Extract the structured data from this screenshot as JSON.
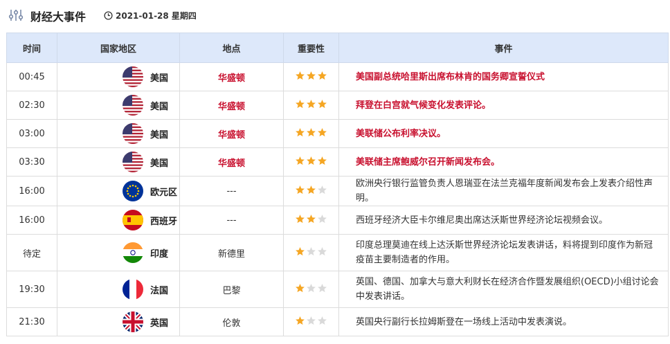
{
  "header": {
    "title": "财经大事件",
    "date": "2021-01-28 星期四"
  },
  "columns": [
    "时间",
    "国家地区",
    "地点",
    "重要性",
    "事件"
  ],
  "rows": [
    {
      "time": "00:45",
      "country": "美国",
      "flag": "us-flag",
      "location": "华盛顿",
      "importance": 3,
      "event": "美国副总统哈里斯出席布林肯的国务卿宣誓仪式",
      "highlight": true
    },
    {
      "time": "02:30",
      "country": "美国",
      "flag": "us-flag",
      "location": "华盛顿",
      "importance": 3,
      "event": "拜登在白宫就气候变化发表评论。",
      "highlight": true
    },
    {
      "time": "03:00",
      "country": "美国",
      "flag": "us-flag",
      "location": "华盛顿",
      "importance": 3,
      "event": "美联储公布利率决议。",
      "highlight": true
    },
    {
      "time": "03:30",
      "country": "美国",
      "flag": "us-flag",
      "location": "华盛顿",
      "importance": 3,
      "event": "美联储主席鲍威尔召开新闻发布会。",
      "highlight": true
    },
    {
      "time": "16:00",
      "country": "欧元区",
      "flag": "eu-flag",
      "location": "---",
      "importance": 2,
      "event": "欧洲央行银行监管负责人恩瑞亚在法兰克福年度新闻发布会上发表介绍性声明。",
      "highlight": false
    },
    {
      "time": "16:00",
      "country": "西班牙",
      "flag": "es-flag",
      "location": "---",
      "importance": 2,
      "event": "西班牙经济大臣卡尔维尼奥出席达沃斯世界经济论坛视频会议。",
      "highlight": false
    },
    {
      "time": "待定",
      "country": "印度",
      "flag": "in-flag",
      "location": "新德里",
      "importance": 1,
      "event": "印度总理莫迪在线上达沃斯世界经济论坛发表讲话，料将提到印度作为新冠疫苗主要制造者的作用。",
      "highlight": false
    },
    {
      "time": "19:30",
      "country": "法国",
      "flag": "fr-flag",
      "location": "巴黎",
      "importance": 1,
      "event": "英国、德国、加拿大与意大利财长在经济合作暨发展组织(OECD)小组讨论会中发表讲话。",
      "highlight": false
    },
    {
      "time": "21:30",
      "country": "英国",
      "flag": "gb-flag",
      "location": "伦敦",
      "importance": 1,
      "event": "英国央行副行长拉姆斯登在一场线上活动中发表演说。",
      "highlight": false
    }
  ],
  "colors": {
    "accent_red": "#c8102e",
    "header_bg": "#dde8fa",
    "star_on": "#f5a623",
    "star_off": "#d9d9d9"
  }
}
